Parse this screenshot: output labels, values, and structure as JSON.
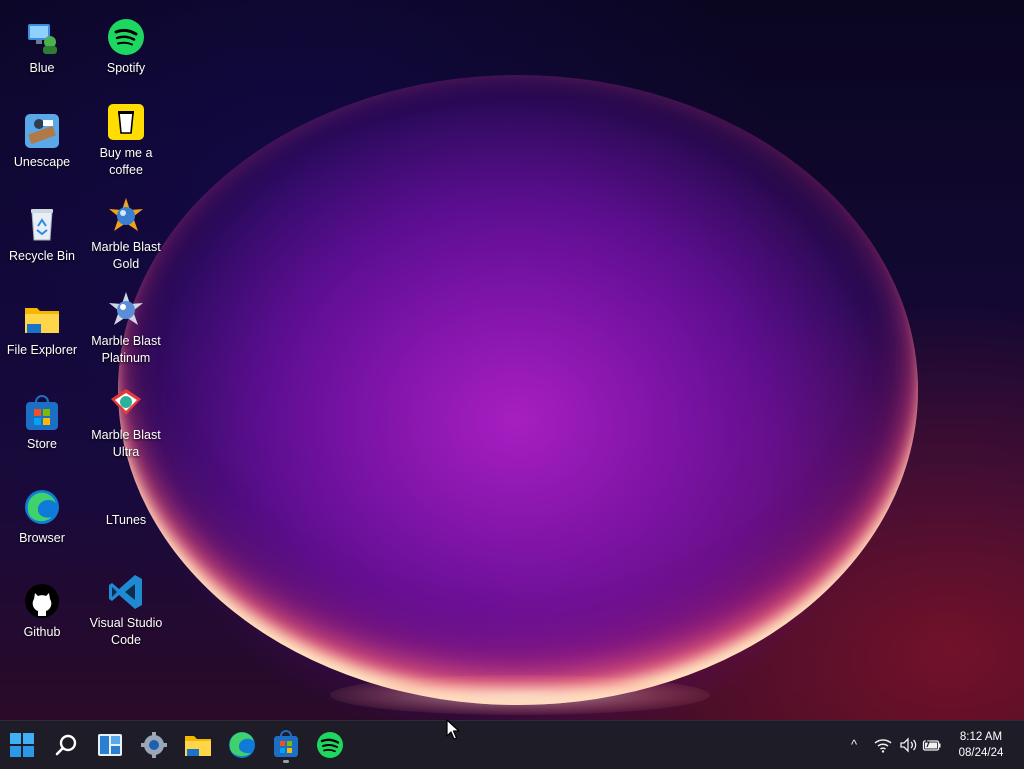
{
  "desktop": {
    "icons": [
      {
        "label": "Blue",
        "icon": "blue-app-icon"
      },
      {
        "label": "Spotify",
        "icon": "spotify-icon"
      },
      {
        "label": "Unescape",
        "icon": "unescape-icon"
      },
      {
        "label": "Buy me a coffee",
        "icon": "coffee-cup-icon"
      },
      {
        "label": "Recycle Bin",
        "icon": "recycle-bin-icon"
      },
      {
        "label": "Marble Blast Gold",
        "icon": "marble-blast-gold-icon"
      },
      {
        "label": "File Explorer",
        "icon": "folder-icon"
      },
      {
        "label": "Marble Blast Platinum",
        "icon": "marble-blast-platinum-icon"
      },
      {
        "label": "Store",
        "icon": "store-icon"
      },
      {
        "label": "Marble Blast Ultra",
        "icon": "marble-blast-ultra-icon"
      },
      {
        "label": "Browser",
        "icon": "edge-browser-icon"
      },
      {
        "label": "LTunes",
        "icon": ""
      },
      {
        "label": "Github",
        "icon": "github-icon"
      },
      {
        "label": "Visual Studio Code",
        "icon": "vscode-icon"
      }
    ]
  },
  "taskbar": {
    "buttons": [
      {
        "name": "start",
        "icon": "windows-start-icon"
      },
      {
        "name": "search",
        "icon": "search-icon"
      },
      {
        "name": "widgets",
        "icon": "widgets-icon"
      },
      {
        "name": "settings",
        "icon": "gear-icon"
      },
      {
        "name": "file-explorer",
        "icon": "folder-icon"
      },
      {
        "name": "browser",
        "icon": "edge-browser-icon"
      },
      {
        "name": "store",
        "icon": "store-icon"
      },
      {
        "name": "spotify",
        "icon": "spotify-icon"
      }
    ],
    "tray": {
      "chevron": "^",
      "wifi_icon": "wifi-icon",
      "volume_icon": "volume-icon",
      "battery_icon": "battery-charging-icon"
    },
    "clock": {
      "time": "8:12 AM",
      "date": "08/24/24"
    }
  },
  "colors": {
    "taskbar_bg": "#1e1c26",
    "spotify_green": "#1ed760",
    "accent_blue": "#0a84d8"
  }
}
